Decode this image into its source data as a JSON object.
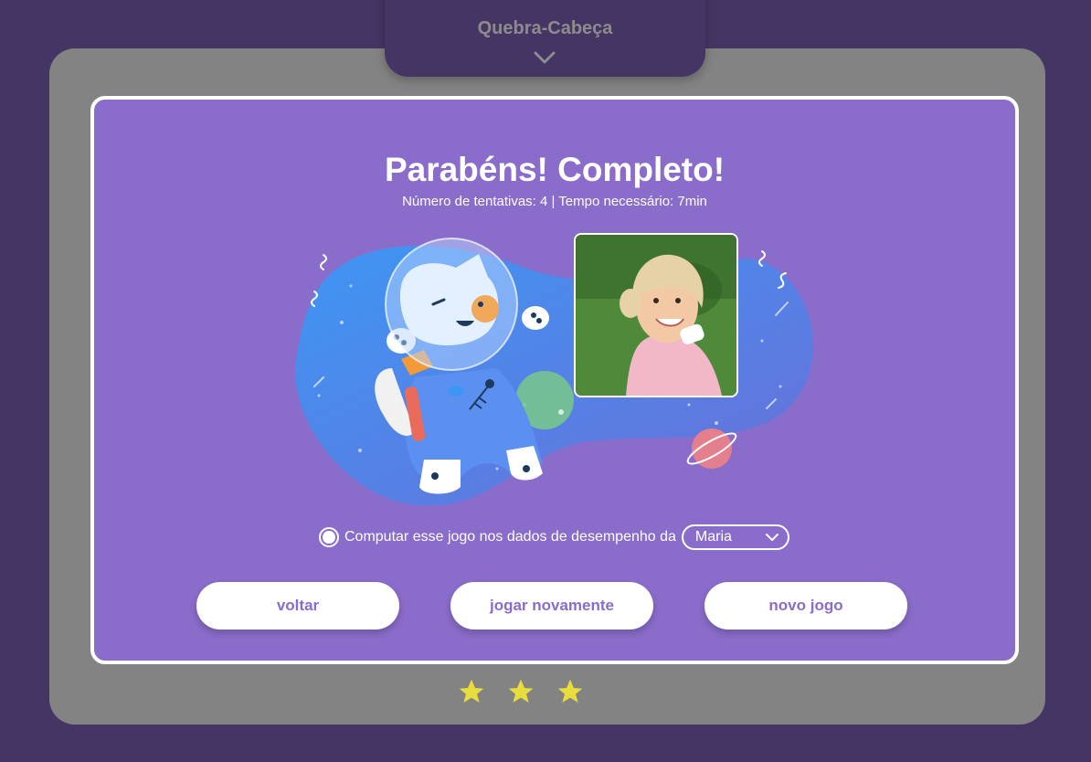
{
  "header": {
    "title": "Quebra-Cabeça",
    "chevron_icon": "chevron-down-icon"
  },
  "result": {
    "title": "Parabéns! Completo!",
    "stats": "Número de tentativas: 4  | Tempo necessário: 7min"
  },
  "illustration": {
    "description_icon": "astronaut-cat-icon",
    "photo_icon": "child-photo"
  },
  "performance": {
    "checkbox_checked": true,
    "label": "Computar esse jogo nos dados de desempenho da",
    "selected_player": "Maria"
  },
  "buttons": {
    "back": "voltar",
    "replay": "jogar novamente",
    "new_game": "novo jogo"
  },
  "rating": {
    "stars": 3,
    "max": 3,
    "color": "#e8dd3c"
  },
  "colors": {
    "background": "#453565",
    "panel": "#838383",
    "card": "#8a6cca",
    "accent_text": "#8a6cca"
  }
}
